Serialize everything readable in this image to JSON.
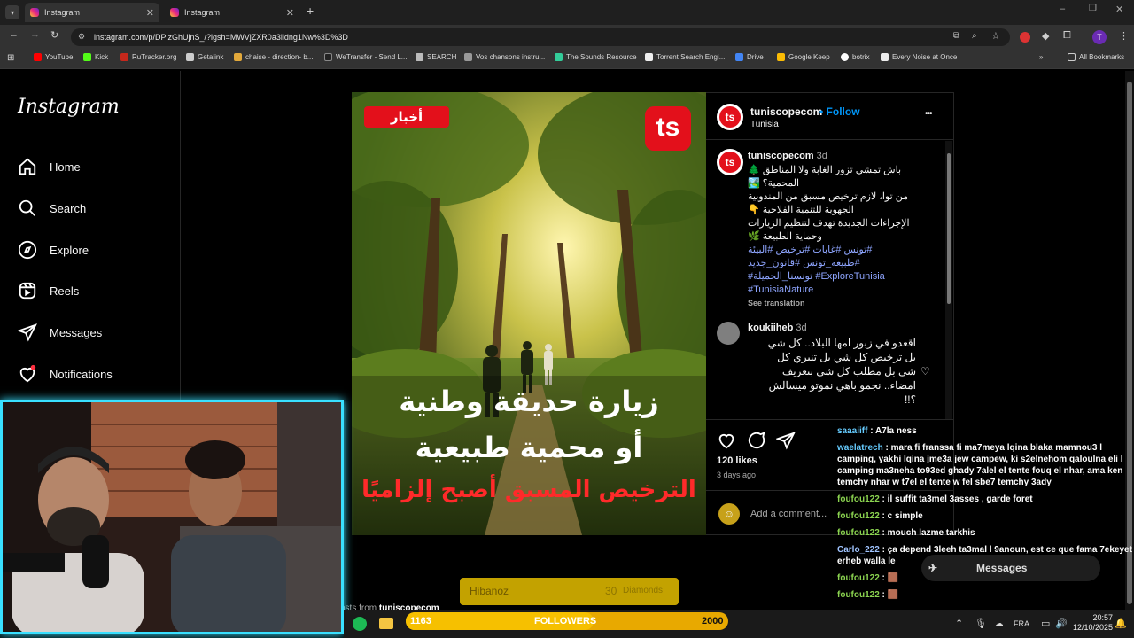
{
  "browser": {
    "tabs": [
      {
        "title": "Instagram"
      },
      {
        "title": "Instagram"
      }
    ],
    "url": "instagram.com/p/DPlzGhUjnS_/?igsh=MWVjZXR0a3lldng1Nw%3D%3D",
    "bookmarks": [
      "YouTube",
      "Kick",
      "RuTracker.org",
      "Getalink",
      "chaise - direction- b...",
      "WeTransfer - Send L...",
      "SEARCH",
      "Vos chansons instru...",
      "The Sounds Resource",
      "Torrent Search Engi...",
      "Drive",
      "Google Keep",
      "botrix",
      "Every Noise at Once"
    ],
    "all_bookmarks": "All Bookmarks",
    "profile_initial": "T"
  },
  "sidebar": {
    "logo": "Instagram",
    "items": [
      {
        "label": "Home",
        "icon": "home-icon"
      },
      {
        "label": "Search",
        "icon": "search-icon"
      },
      {
        "label": "Explore",
        "icon": "compass-icon"
      },
      {
        "label": "Reels",
        "icon": "reels-icon"
      },
      {
        "label": "Messages",
        "icon": "send-icon"
      },
      {
        "label": "Notifications",
        "icon": "heart-icon"
      }
    ]
  },
  "post": {
    "image": {
      "tag": "أخبار",
      "logo": "ts",
      "headline_1": "زيارة حديقة وطنية",
      "headline_2": "أو محمية طبيعية",
      "headline_3": "الترخيص المسبق أصبح إلزاميًا"
    },
    "header": {
      "username": "tuniscopecom",
      "follow": "Follow",
      "location": "Tunisia",
      "more": "•••"
    },
    "caption": {
      "username": "tuniscopecom",
      "time": "3d",
      "line1": "باش تمشي تزور الغابة ولا المناطق 🌲",
      "line2": "المحمية؟ 🏞️",
      "line3": "من توا، لازم ترخيص مسبق من المندوبية",
      "line4": "الجهوية للتنمية الفلاحية 👇",
      "line5": "الإجراءات الجديدة تهدف لتنظيم الزيارات",
      "line6": "وحماية الطبيعة 🌿",
      "hash1": "#تونس #غابات #ترخيص #البيئة",
      "hash2": "#طبيعة_تونس #قانون_جديد",
      "hash3": "#تونسنا_الجميلة #ExploreTunisia",
      "hash4": "#TunisiaNature",
      "see_translation": "See translation"
    },
    "comment": {
      "username": "koukiiheb",
      "time": "3d",
      "line1": "اقعدو في زبور امها البلاد.. كل شي",
      "line2": "بل ترخيص كل شي بل تنبري كل",
      "line3": "شي بل مطلب كل شي بتعريف",
      "line4": "امضاء.. نجمو باهي نموتو ميسالش",
      "line5": "؟!!"
    },
    "likes": "120 likes",
    "date": "3 days ago",
    "add_comment": "Add a comment..."
  },
  "below_post": {
    "more_from_prefix": "osts from",
    "more_from_user": "tuniscopecom"
  },
  "stream_overlay": {
    "goal_name": "Hibanoz",
    "goal_amount": "30",
    "goal_unit": "Diamonds",
    "followers_label": "FOLLOWERS",
    "followers_current": "1163",
    "followers_target": "2000",
    "followers_progress": 0.5815,
    "messages_popup": "Messages",
    "chat": [
      {
        "user": "saaaiiff",
        "text": "A7la ness"
      },
      {
        "user": "waelatrech",
        "text": "mara fi franssa fi ma7meya lqina blaka mamnou3 l camping, yakhi lqina jme3a jew campew, ki s2elnehom qaloulna eli l camping ma3neha to93ed ghady 7alel el tente fouq el nhar, ama ken temchy nhar w t7el el tente w fel sbe7 temchy 3ady"
      },
      {
        "user": "foufou122",
        "text": "il suffit ta3mel 3asses , garde foret"
      },
      {
        "user": "foufou122",
        "text": "c simple"
      },
      {
        "user": "foufou122",
        "text": "mouch lazme tarkhis"
      },
      {
        "user": "Carlo_222",
        "text": "ça depend 3leeh ta3mal l 9anoun, est ce que fama 7ekeyet erheb walla le"
      },
      {
        "user": "foufou122",
        "text": "🟫"
      },
      {
        "user": "foufou122",
        "text": "🟫"
      },
      {
        "user": "foufou122",
        "text": "🟫"
      }
    ]
  },
  "taskbar": {
    "lang": "FRA",
    "time": "20:57",
    "date": "12/10/2025"
  },
  "colors": {
    "accent_blue": "#0095f6",
    "followers_bar": "#e8a900",
    "webcam_border": "#39e0ff",
    "chat_user": "#66ccff"
  }
}
